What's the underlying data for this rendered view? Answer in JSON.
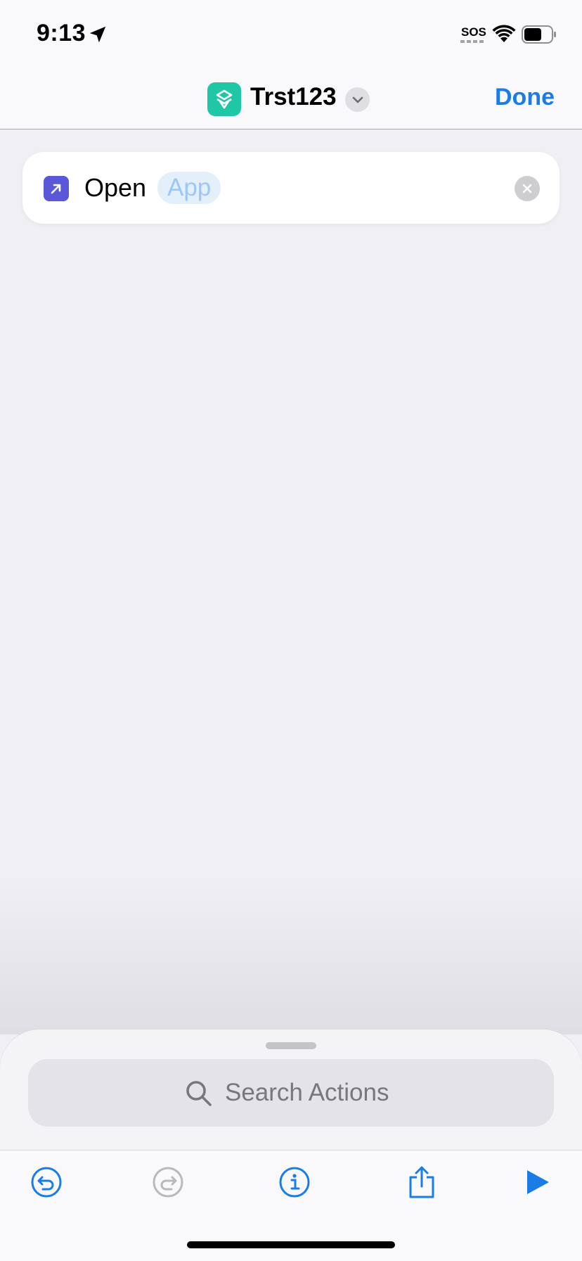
{
  "status_bar": {
    "time": "9:13",
    "sos": "SOS",
    "icons": [
      "location-arrow-icon",
      "wifi-icon",
      "battery-icon"
    ]
  },
  "nav": {
    "title": "Trst123",
    "done_label": "Done",
    "icons": [
      "shortcuts-app-icon",
      "chevron-down-icon"
    ]
  },
  "action": {
    "verb": "Open",
    "parameter_placeholder": "App",
    "icons": [
      "open-app-arrow-icon",
      "remove-x-icon"
    ]
  },
  "search": {
    "placeholder": "Search Actions"
  },
  "toolbar": {
    "buttons": [
      "undo-icon",
      "redo-icon",
      "info-icon",
      "share-icon",
      "play-icon"
    ]
  },
  "colors": {
    "accent": "#1c7ce6",
    "app_icon": "#1fc7a6",
    "action_icon": "#5a57d8",
    "param_bg": "#e4effc",
    "param_text": "#9cc8f3"
  }
}
